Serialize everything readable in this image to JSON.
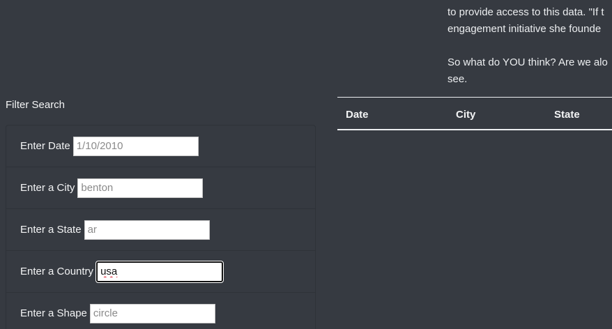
{
  "article": {
    "line1": "to provide access to this data. \"If t",
    "line2": "engagement initiative she founde",
    "line3": "So what do YOU think? Are we alo",
    "line4": "see."
  },
  "filter": {
    "title": "Filter Search",
    "fields": [
      {
        "label": "Enter Date",
        "placeholder": "1/10/2010",
        "value": ""
      },
      {
        "label": "Enter a City",
        "placeholder": "benton",
        "value": ""
      },
      {
        "label": "Enter a State",
        "placeholder": "ar",
        "value": ""
      },
      {
        "label": "Enter a Country",
        "placeholder": "",
        "value": "usa"
      },
      {
        "label": "Enter a Shape",
        "placeholder": "circle",
        "value": ""
      }
    ]
  },
  "table": {
    "headers": [
      "Date",
      "City",
      "State"
    ]
  }
}
